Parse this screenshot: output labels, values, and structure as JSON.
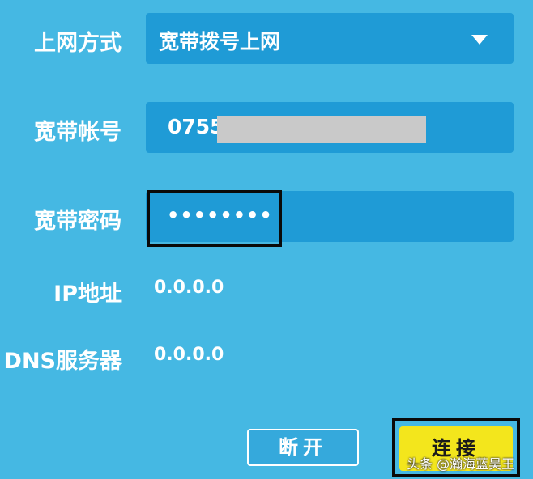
{
  "form": {
    "connection_type": {
      "label": "上网方式",
      "value": "宽带拨号上网"
    },
    "account": {
      "label": "宽带帐号",
      "value": "0755"
    },
    "password": {
      "label": "宽带密码",
      "value": "••••••••"
    },
    "ip": {
      "label": "IP地址",
      "value": "0.0.0.0"
    },
    "dns": {
      "label": "DNS服务器",
      "value": "0.0.0.0"
    }
  },
  "buttons": {
    "disconnect": "断开",
    "connect": "连接"
  },
  "watermark": "头条 @瀚海蓝昊王",
  "colors": {
    "background": "#45b8e3",
    "field": "#1f9bd6",
    "connect_button": "#f3e61c",
    "highlight_border": "#0a0a0a"
  },
  "icons": {
    "dropdown": "chevron-down-icon"
  }
}
